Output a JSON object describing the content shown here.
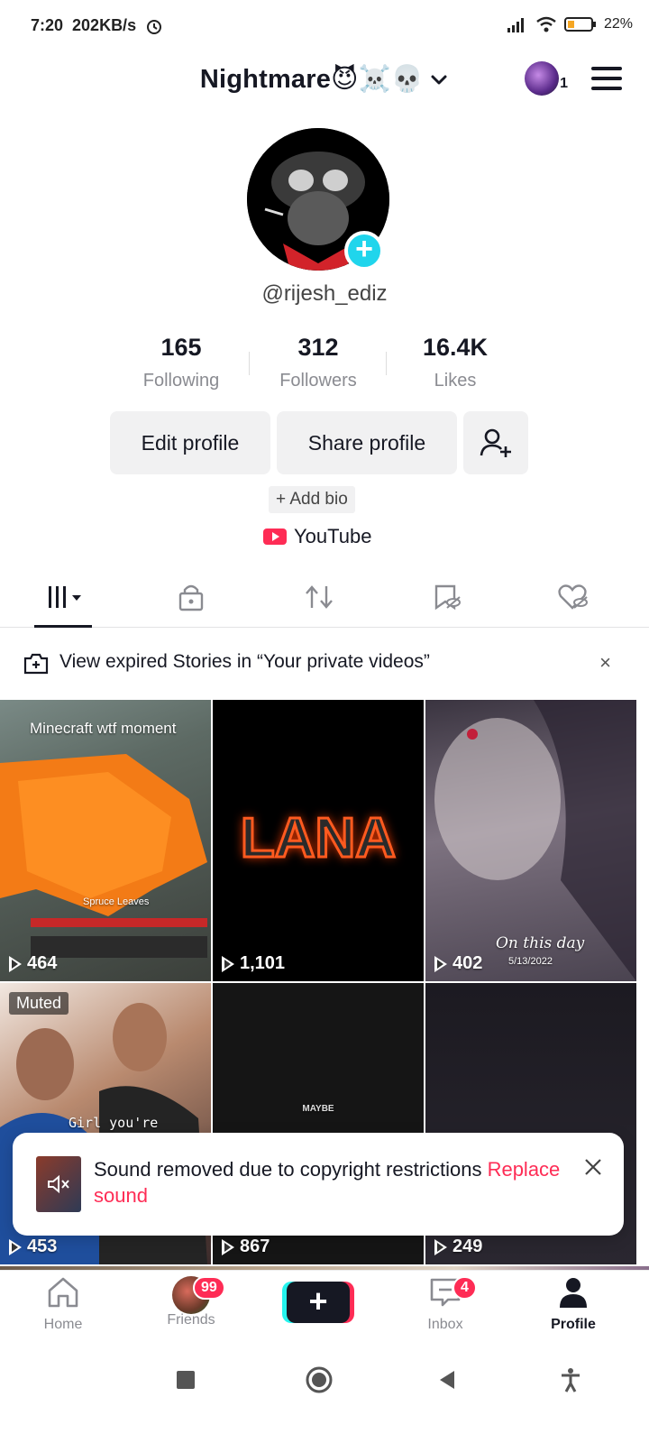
{
  "status_bar": {
    "time": "7:20",
    "speed": "202KB/s",
    "battery": "22%"
  },
  "header": {
    "title": "Nightmare😈☠️💀",
    "account_badge": "1"
  },
  "profile": {
    "handle": "@rijesh_ediz",
    "stats": [
      {
        "value": "165",
        "label": "Following"
      },
      {
        "value": "312",
        "label": "Followers"
      },
      {
        "value": "16.4K",
        "label": "Likes"
      }
    ],
    "edit_label": "Edit profile",
    "share_label": "Share profile",
    "add_bio": "+ Add bio",
    "link_label": "YouTube"
  },
  "banner": {
    "text": "View expired Stories in “Your private videos”",
    "close": "×"
  },
  "videos": [
    {
      "views": "464",
      "caption": "Minecraft wtf moment",
      "sub": "Spruce Leaves"
    },
    {
      "views": "1,101",
      "caption": "LANA"
    },
    {
      "views": "402",
      "caption": "On this day",
      "sub": "5/13/2022"
    },
    {
      "views": "453",
      "badge": "Muted",
      "caption": "Girl you're"
    },
    {
      "views": "867",
      "caption": "MAYBE"
    },
    {
      "views": "249"
    }
  ],
  "toast": {
    "message": "Sound removed due to copyright restrictions",
    "action": "Replace sound"
  },
  "bottom_nav": {
    "home": "Home",
    "friends": "Friends",
    "friends_badge": "99",
    "inbox": "Inbox",
    "inbox_badge": "4",
    "profile": "Profile"
  },
  "colors": {
    "accent": "#fe2c55",
    "cyan": "#20d5ec",
    "text": "#161823",
    "muted": "#8a8b91"
  }
}
